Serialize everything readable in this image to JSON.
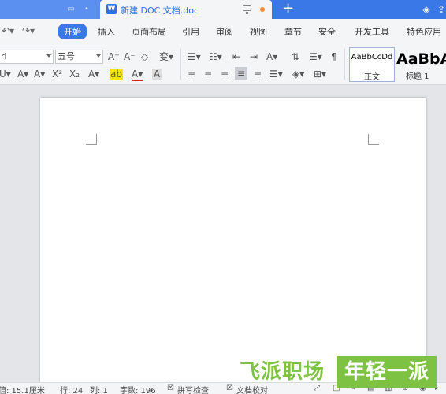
{
  "tabs": {
    "active_title": "新建 DOC 文档.doc",
    "doc_badge": "W",
    "new_tab_symbol": "+"
  },
  "menu": {
    "items": [
      "开始",
      "插入",
      "页面布局",
      "引用",
      "审阅",
      "视图",
      "章节",
      "安全",
      "开发工具",
      "特色应用"
    ]
  },
  "ribbon": {
    "font_name": "ri",
    "font_size": "五号",
    "styles": {
      "normal_sample": "AaBbCcDd",
      "normal_label": "正文",
      "heading_sample": "AaBbA",
      "heading_label": "标题 1"
    }
  },
  "statusbar": {
    "position": "值: 15.1厘米",
    "line": "行: 24",
    "column": "列: 1",
    "word_count": "字数: 196",
    "spell_check": "拼写检查",
    "doc_check": "文档校对"
  },
  "watermark": {
    "left": "飞派职场",
    "right": "年轻一派"
  },
  "colors": {
    "accent": "#3b78e7",
    "watermark_green": "#7dc242"
  }
}
